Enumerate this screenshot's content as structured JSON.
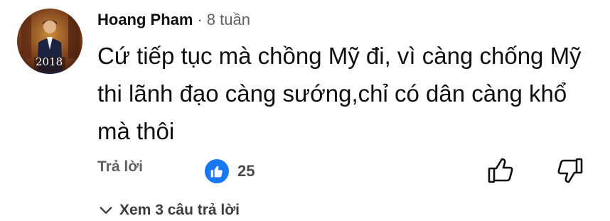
{
  "comment": {
    "author": "Hoang Pham",
    "separator": "·",
    "time": "8 tuần",
    "text": "Cứ tiếp tục mà chồng Mỹ đi, vì càng chống Mỹ thi lãnh đạo càng sướng,chỉ có dân càng khổ mà thôi",
    "avatar_overlay": "2018"
  },
  "actions": {
    "reply_label": "Trả lời",
    "like_count": "25",
    "like_badge_color": "#1877f2",
    "thumbs_up_icon": "thumbs-up-outline",
    "thumbs_down_icon": "thumbs-down-outline"
  },
  "replies": {
    "toggle_label": "Xem 3 câu trả lời",
    "toggle_icon": "chevron-down"
  }
}
